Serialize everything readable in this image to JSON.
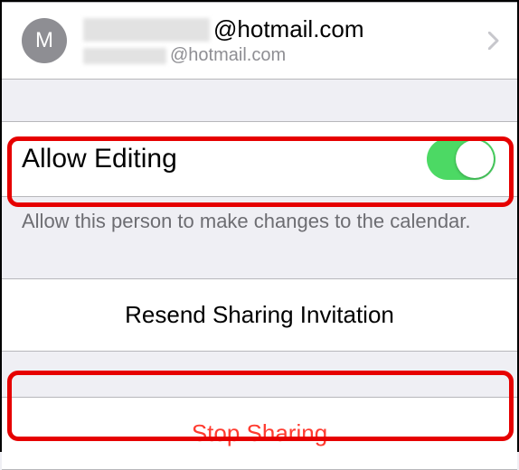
{
  "contact": {
    "avatar_initial": "M",
    "primary_suffix": "@hotmail.com",
    "secondary_suffix": "@hotmail.com"
  },
  "allow_editing": {
    "label": "Allow Editing",
    "on": true,
    "footer": "Allow this person to make changes to the calendar."
  },
  "actions": {
    "resend": "Resend Sharing Invitation",
    "stop": "Stop Sharing"
  }
}
